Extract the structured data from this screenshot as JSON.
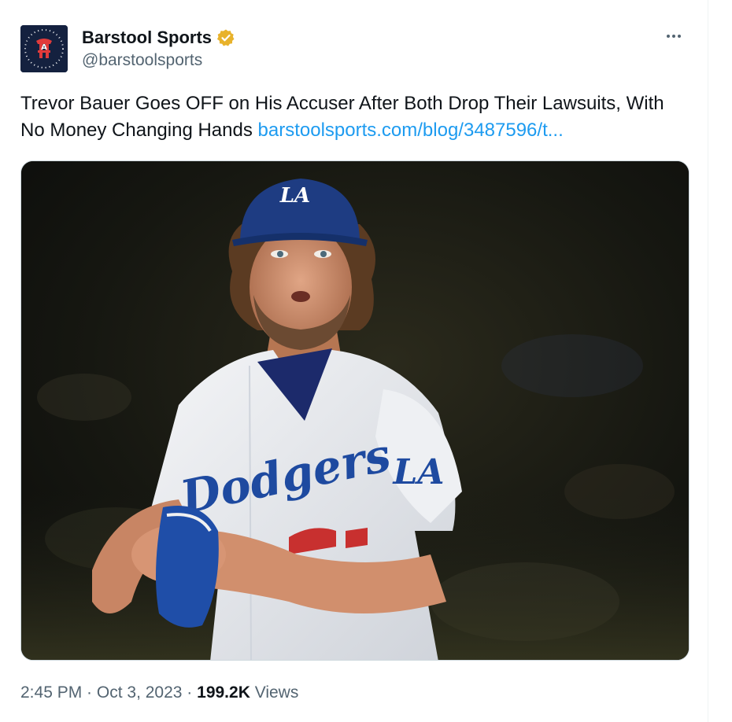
{
  "author": {
    "display_name": "Barstool Sports",
    "handle": "@barstoolsports",
    "avatar_icon": "barstool-logo-icon",
    "verified_icon": "verified-gold-badge-icon",
    "avatar_colors": {
      "background": "#14213f",
      "accent": "#e03b3b"
    }
  },
  "tweet": {
    "text": "Trevor Bauer Goes OFF on His Accuser After Both Drop Their Lawsuits, With No Money Changing Hands ",
    "link_text": "barstoolsports.com/blog/3487596/t...",
    "image_alt_icon": "dodgers-pitcher-photo",
    "jersey_text": "Dodgers",
    "cap_logo": "LA",
    "sleeve_logo": "LA"
  },
  "meta": {
    "time": "2:45 PM",
    "separator1": " · ",
    "date": "Oct 3, 2023",
    "separator2": " · ",
    "views_count": "199.2K",
    "views_label": " Views"
  },
  "colors": {
    "link": "#1d9bf0",
    "secondary_text": "#536471",
    "verified_gold": "#e8b22b",
    "dodger_blue": "#1e4aa0"
  }
}
